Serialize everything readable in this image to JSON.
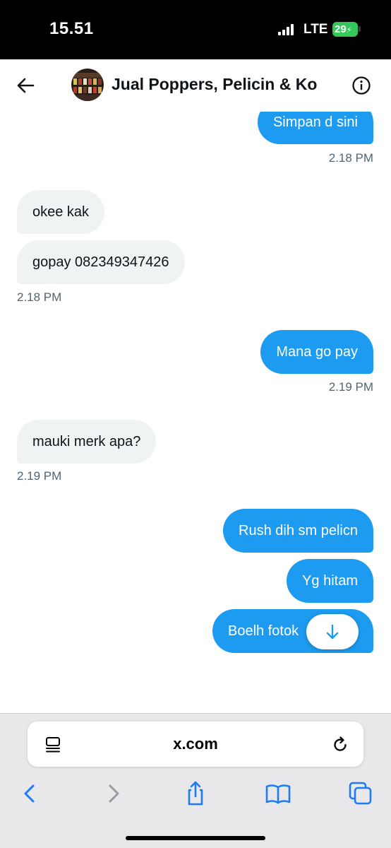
{
  "status_bar": {
    "time": "15.51",
    "network": "LTE",
    "battery": "29"
  },
  "header": {
    "title": "Jual Poppers, Pelicin & Ko"
  },
  "messages": [
    {
      "text": "Simpan d sini"
    },
    {
      "text": "okee kak"
    },
    {
      "text": "gopay 082349347426"
    },
    {
      "text": "Mana go pay"
    },
    {
      "text": "mauki merk apa?"
    },
    {
      "text": "Rush dih sm pelicn"
    },
    {
      "text": "Yg hitam"
    },
    {
      "text": "Boelh fotok"
    }
  ],
  "timestamps": [
    "2.18 PM",
    "2.18 PM",
    "2.19 PM",
    "2.19 PM"
  ],
  "browser": {
    "url": "x.com"
  },
  "colors": {
    "accent": "#1d9bf0",
    "received_bubble": "#eff3f4",
    "battery": "#34c759"
  }
}
